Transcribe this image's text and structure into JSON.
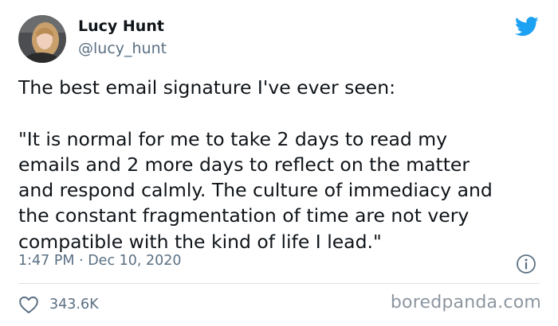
{
  "author": {
    "name": "Lucy Hunt",
    "handle": "@lucy_hunt"
  },
  "tweet": {
    "lines": [
      "The best email signature I've ever seen:",
      "",
      "\"It is normal for me to take 2 days to read my",
      "emails and 2 more days to reflect on the matter",
      "and respond calmly. The culture of immediacy and",
      "the constant fragmentation of time are not very",
      "compatible with the kind of life I lead.\""
    ],
    "timestamp": "1:47 PM · Dec 10, 2020",
    "likes": "343.6K"
  },
  "icons": {
    "brand": "twitter-bird-icon",
    "info": "info-icon",
    "like": "heart-icon"
  },
  "colors": {
    "brand_blue": "#1da1f2",
    "secondary_text": "#5b7083",
    "divider": "#dbe2e8"
  },
  "watermark": "boredpanda.com"
}
